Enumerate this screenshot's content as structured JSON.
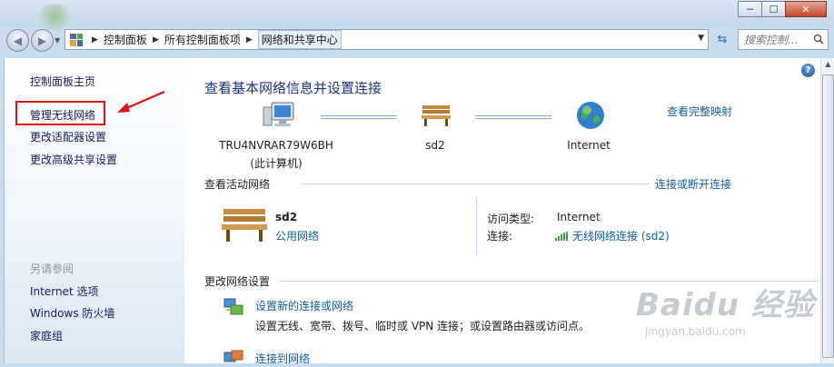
{
  "window": {
    "buttons": [
      "─",
      "☐",
      "✕"
    ]
  },
  "nav": {
    "breadcrumbs": [
      "控制面板",
      "所有控制面板项",
      "网络和共享中心"
    ],
    "search_placeholder": "搜索控制..."
  },
  "sidebar": {
    "items": [
      {
        "label": "控制面板主页"
      },
      {
        "label": "管理无线网络"
      },
      {
        "label": "更改适配器设置"
      },
      {
        "label": "更改高级共享设置"
      }
    ],
    "see_also_title": "另请参阅",
    "see_also": [
      {
        "label": "Internet 选项"
      },
      {
        "label": "Windows 防火墙"
      },
      {
        "label": "家庭组"
      }
    ]
  },
  "main": {
    "title": "查看基本网络信息并设置连接",
    "full_map_link": "查看完整映射",
    "map_nodes": [
      {
        "name": "TRU4NVRAR79W6BH",
        "sub": "(此计算机)",
        "icon": "computer-icon"
      },
      {
        "name": "sd2",
        "icon": "bench-icon"
      },
      {
        "name": "Internet",
        "icon": "globe-icon"
      }
    ],
    "active_title": "查看活动网络",
    "connect_link": "连接或断开连接",
    "active_network": {
      "name": "sd2",
      "type": "公用网络",
      "access_label": "访问类型:",
      "access_value": "Internet",
      "conn_label": "连接:",
      "conn_value": "无线网络连接 (sd2)"
    },
    "change_title": "更改网络设置",
    "tasks": [
      {
        "link": "设置新的连接或网络",
        "desc": "设置无线、宽带、拨号、临时或 VPN 连接；或设置路由器或访问点。"
      },
      {
        "link": "连接到网络"
      }
    ]
  },
  "watermark": {
    "main": "Baidu 经验",
    "sub": "jingyan.baidu.com"
  },
  "colors": {
    "link": "#0f5f9c",
    "title": "#1e3287",
    "highlight": "#e0120f"
  }
}
